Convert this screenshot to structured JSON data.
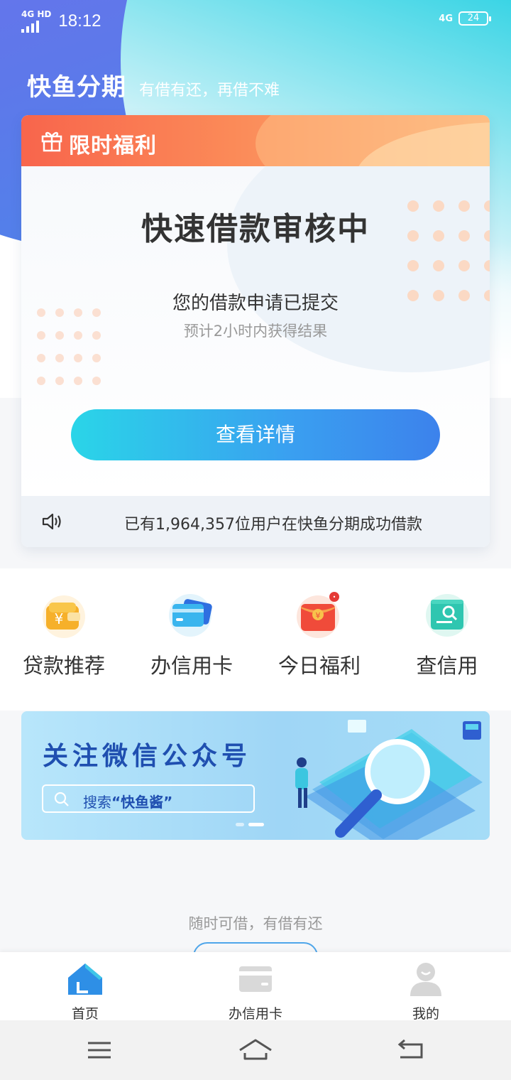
{
  "status_bar": {
    "network": "4G HD",
    "time": "18:12",
    "network_right": "4G",
    "battery": "24"
  },
  "header": {
    "app_name": "快鱼分期",
    "slogan": "有借有还，再借不难"
  },
  "promo_card": {
    "badge": "限时福利",
    "title": "快速借款审核中",
    "status_line": "您的借款申请已提交",
    "eta_line": "预计2小时内获得结果",
    "button": "查看详情",
    "notice": "已有1,964,357位用户在快鱼分期成功借款"
  },
  "quick_actions": [
    {
      "label": "贷款推荐",
      "icon": "yuan-wallet-icon"
    },
    {
      "label": "办信用卡",
      "icon": "credit-card-icon"
    },
    {
      "label": "今日福利",
      "icon": "red-envelope-icon"
    },
    {
      "label": "查信用",
      "icon": "credit-report-icon"
    }
  ],
  "banner": {
    "title": "关注微信公众号",
    "search_prefix": "搜索",
    "search_keyword": "“快鱼酱”"
  },
  "tagline": "随时可借，有借有还",
  "tab_bar": [
    {
      "label": "首页",
      "icon": "home-icon",
      "active": true
    },
    {
      "label": "办信用卡",
      "icon": "card-icon",
      "active": false
    },
    {
      "label": "我的",
      "icon": "profile-icon",
      "active": false
    }
  ],
  "colors": {
    "accent": "#3a9ff0",
    "promo_orange": "#f8654c",
    "banner_text": "#1f4fb0"
  }
}
